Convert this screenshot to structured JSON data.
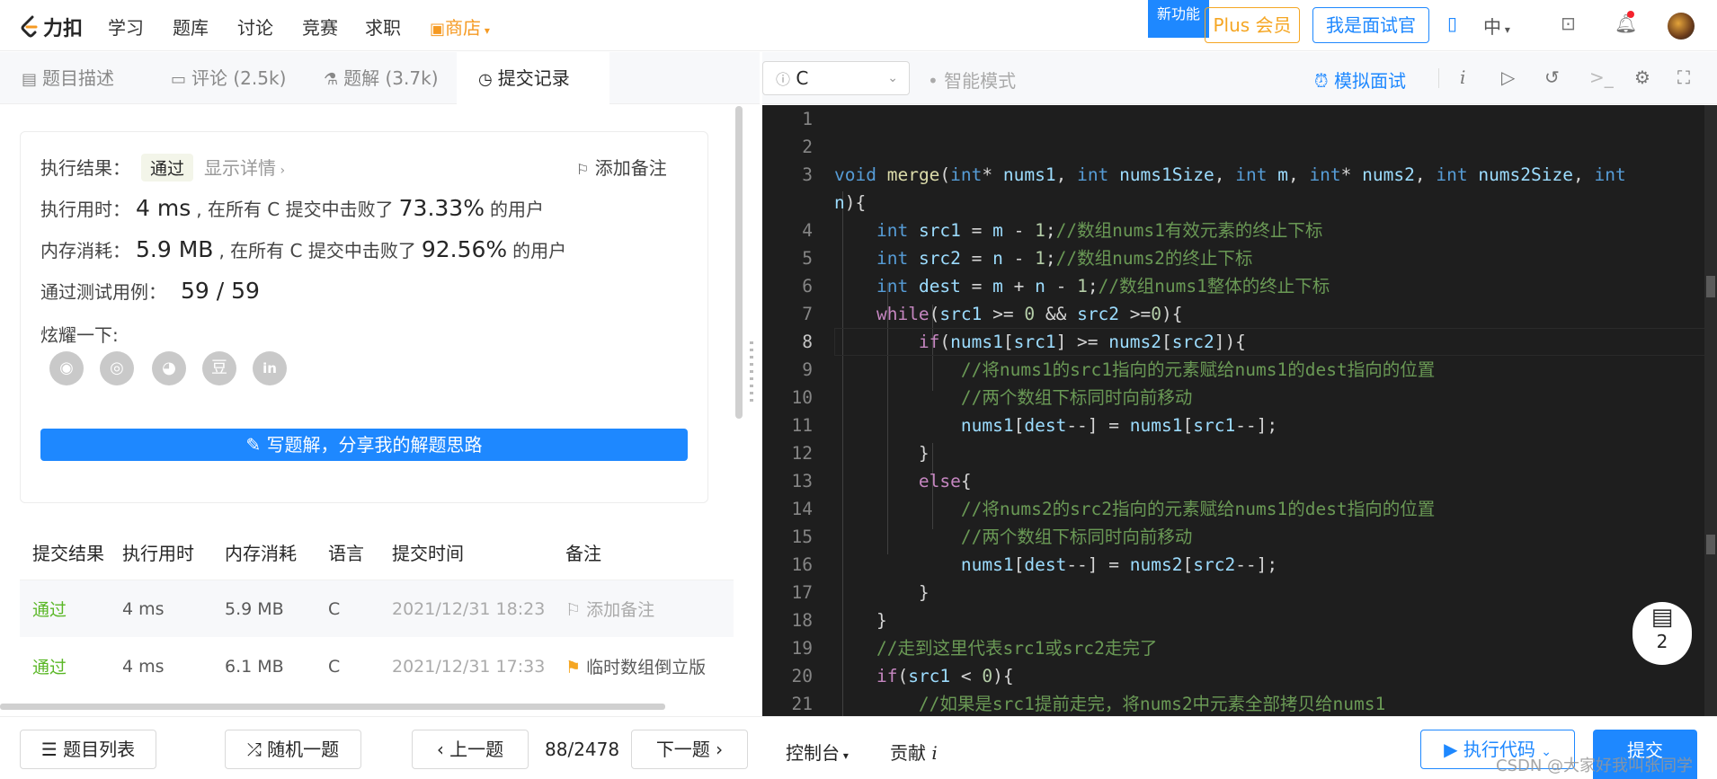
{
  "nav": {
    "brand": "力扣",
    "items": [
      "学习",
      "题库",
      "讨论",
      "竞赛",
      "求职"
    ],
    "shop": "商店",
    "new_feature": "新功能",
    "plus": "Plus 会员",
    "interviewer": "我是面试官",
    "lang_toggle": "中"
  },
  "tabs": [
    {
      "label": "题目描述",
      "icon": "description-icon"
    },
    {
      "label": "评论 (2.5k)",
      "icon": "comment-icon"
    },
    {
      "label": "题解 (3.7k)",
      "icon": "solution-icon"
    },
    {
      "label": "提交记录",
      "icon": "history-icon"
    }
  ],
  "result": {
    "label": "执行结果：",
    "status": "通过",
    "details": "显示详情",
    "add_note": "添加备注",
    "time_label": "执行用时：",
    "time_value": "4 ms",
    "time_mid": ", 在所有 C 提交中击败了",
    "time_pct": "73.33%",
    "suffix": "的用户",
    "mem_label": "内存消耗：",
    "mem_value": "5.9 MB",
    "mem_mid": ", 在所有 C 提交中击败了",
    "mem_pct": "92.56%",
    "tests_label": "通过测试用例：",
    "tests_value": "59 / 59",
    "share_label": "炫耀一下:",
    "write_solution": "写题解，分享我的解题思路"
  },
  "submissions": {
    "headers": [
      "提交结果",
      "执行用时",
      "内存消耗",
      "语言",
      "提交时间",
      "备注"
    ],
    "rows": [
      {
        "status": "通过",
        "time": "4 ms",
        "memory": "5.9 MB",
        "lang": "C",
        "submitted": "2021/12/31 18:23",
        "note": "添加备注"
      },
      {
        "status": "通过",
        "time": "4 ms",
        "memory": "6.1 MB",
        "lang": "C",
        "submitted": "2021/12/31 17:33",
        "note": "临时数组倒立版"
      }
    ]
  },
  "editor": {
    "language": "C",
    "smart_mode": "智能模式",
    "mock_interview": "模拟面试",
    "line_numbers": [
      "1",
      "2",
      "3",
      "",
      "4",
      "5",
      "6",
      "7",
      "8",
      "9",
      "10",
      "11",
      "12",
      "13",
      "14",
      "15",
      "16",
      "17",
      "18",
      "19",
      "20",
      "21"
    ],
    "solutions_count": "2"
  },
  "bottom": {
    "problem_list": "题目列表",
    "random": "随机一题",
    "prev": "上一题",
    "progress": "88/2478",
    "next": "下一题",
    "console": "控制台",
    "contribute": "贡献",
    "run_code": "执行代码",
    "submit": "提交"
  },
  "watermark": "CSDN @大家好我叫张同学"
}
